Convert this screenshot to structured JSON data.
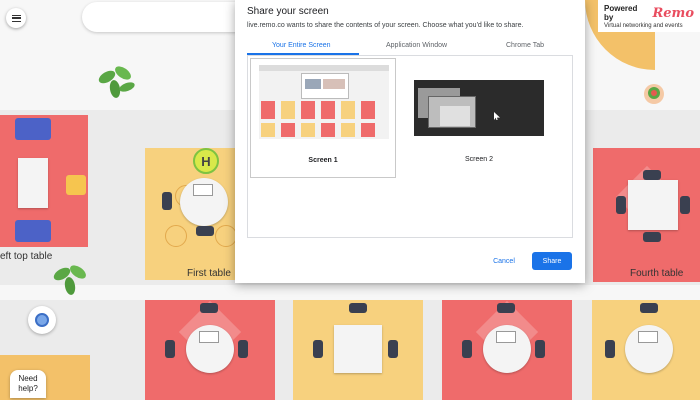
{
  "floor": {
    "table_labels": {
      "left_top": "eft top table",
      "first": "First table",
      "fourth": "Fourth table"
    },
    "avatar_initial": "H"
  },
  "brand": {
    "powered_by": "Powered by",
    "name": "Remo",
    "tagline": "Virtual networking and events"
  },
  "help": {
    "line1": "Need",
    "line2": "help?"
  },
  "dialog": {
    "title": "Share your screen",
    "description": "live.remo.co wants to share the contents of your screen. Choose what you'd like to share.",
    "tabs": [
      {
        "label": "Your Entire Screen",
        "active": true
      },
      {
        "label": "Application Window",
        "active": false
      },
      {
        "label": "Chrome Tab",
        "active": false
      }
    ],
    "screens": [
      {
        "label": "Screen 1",
        "selected": true
      },
      {
        "label": "Screen 2",
        "selected": false
      }
    ],
    "cancel_label": "Cancel",
    "share_label": "Share"
  },
  "colors": {
    "accent": "#1a73e8",
    "pink_tile": "#ef6b6b",
    "yellow_tile": "#f7d17e",
    "remo_brand": "#e94d5f"
  }
}
